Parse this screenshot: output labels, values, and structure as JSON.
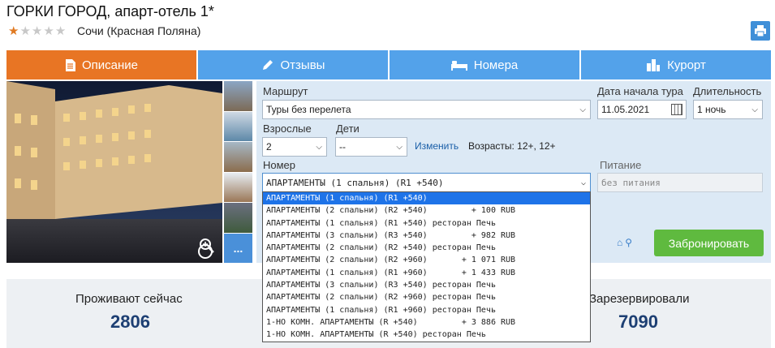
{
  "hotel": {
    "name": "ГОРКИ ГОРОД, апарт-отель 1*",
    "rating": 1,
    "location": "Сочи (Красная Поляна)"
  },
  "icons": {
    "print": "printer-icon",
    "zoom": "zoom-in-icon",
    "more": "..."
  },
  "colors": {
    "tab_active": "#e87524",
    "tab": "#53a2ea",
    "book_button": "#5fba3f",
    "panel_bg": "#dce9f5",
    "selected_option": "#1e73e8",
    "stat_value": "#1d3f73"
  },
  "tabs": [
    {
      "label": "Описание",
      "icon": "document-icon",
      "active": true
    },
    {
      "label": "Отзывы",
      "icon": "pencil-icon",
      "active": false
    },
    {
      "label": "Номера",
      "icon": "bed-icon",
      "active": false
    },
    {
      "label": "Курорт",
      "icon": "buildings-icon",
      "active": false
    }
  ],
  "search": {
    "route_label": "Маршрут",
    "route_value": "Туры без перелета",
    "date_label": "Дата начала тура",
    "date_value": "11.05.2021",
    "duration_label": "Длительность",
    "duration_value": "1 ночь",
    "adults_label": "Взрослые",
    "adults_value": "2",
    "children_label": "Дети",
    "children_value": "--",
    "change_link": "Изменить",
    "ages_text": "Возрасты: 12+, 12+",
    "room_label": "Номер",
    "room_value": "АПАРТАМЕНТЫ (1 спальня) (R1 +540)",
    "meal_label": "Питание",
    "meal_value": "без питания",
    "book_button": "Забронировать"
  },
  "room_options": [
    "АПАРТАМЕНТЫ (1 спальня) (R1 +540)",
    "АПАРТАМЕНТЫ (2 спальни) (R2 +540)         + 100 RUB",
    "АПАРТАМЕНТЫ (1 спальня) (R1 +540) ресторан Печь",
    "АПАРТАМЕНТЫ (3 спальни) (R3 +540)         + 982 RUB",
    "АПАРТАМЕНТЫ (2 спальни) (R2 +540) ресторан Печь",
    "АПАРТАМЕНТЫ (2 спальни) (R2 +960)       + 1 071 RUB",
    "АПАРТАМЕНТЫ (1 спальня) (R1 +960)       + 1 433 RUB",
    "АПАРТАМЕНТЫ (3 спальни) (R3 +540) ресторан Печь",
    "АПАРТАМЕНТЫ (2 спальни) (R2 +960) ресторан Печь",
    "АПАРТАМЕНТЫ (1 спальня) (R1 +960) ресторан Печь",
    "1-НО КОМН. АПАРТАМЕНТЫ (R +540)         + 3 886 RUB",
    "1-НО КОМН. АПАРТАМЕНТЫ (R +540) ресторан Печь"
  ],
  "stats": {
    "living_label": "Проживают сейчас",
    "living_value": "2806",
    "reserved_label": "Зарезервировали",
    "reserved_value": "7090"
  }
}
